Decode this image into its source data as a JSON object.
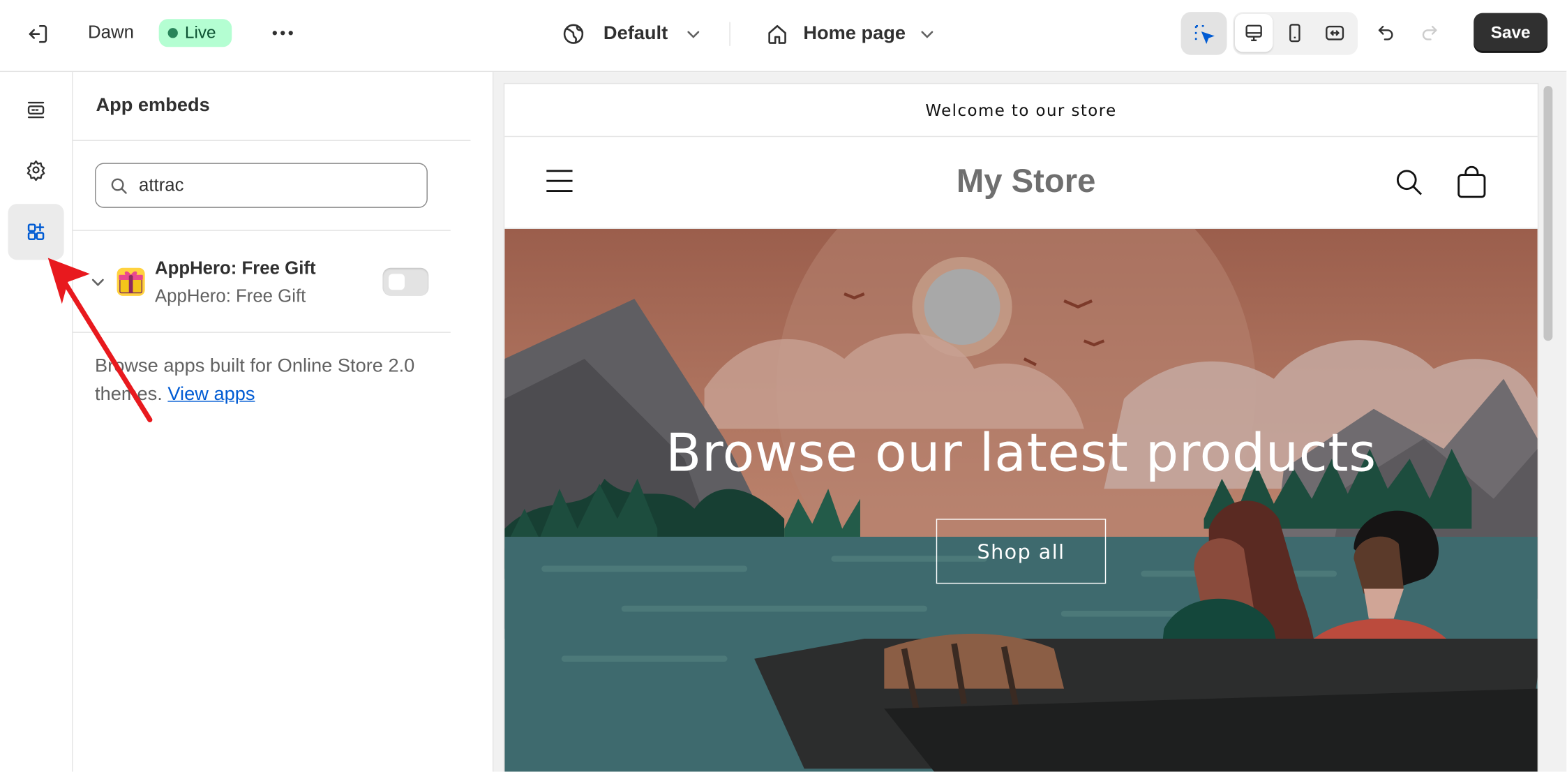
{
  "topbar": {
    "exit_icon": "exit-icon",
    "theme_name": "Dawn",
    "live_label": "Live",
    "more_icon": "more-horizontal-icon",
    "language_icon": "globe-icon",
    "language_label": "Default",
    "page_icon": "home-icon",
    "page_label": "Home page",
    "inspector_icon": "inspector-cursor-icon",
    "view_icons": [
      "desktop-icon",
      "mobile-icon",
      "fullscreen-icon"
    ],
    "undo_icon": "undo-icon",
    "redo_icon": "redo-icon",
    "save_label": "Save"
  },
  "rail": {
    "items": [
      {
        "icon": "sections-icon"
      },
      {
        "icon": "settings-gear-icon"
      },
      {
        "icon": "app-embeds-icon",
        "active": true
      }
    ]
  },
  "panel": {
    "title": "App embeds",
    "search": {
      "value": "attrac",
      "placeholder": "Search app embeds"
    },
    "apps": [
      {
        "title": "AppHero: Free Gift",
        "subtitle": "AppHero: Free Gift",
        "enabled": false
      }
    ],
    "browse_text": "Browse apps built for Online Store 2.0 themes.",
    "browse_link": "View apps"
  },
  "preview": {
    "announcement": "Welcome to our store",
    "store_name": "My Store",
    "hero_heading": "Browse our latest products",
    "hero_button": "Shop all"
  },
  "colors": {
    "live_badge_bg": "#b4fed2",
    "accent_blue": "#005bd3",
    "save_bg": "#303030",
    "annotation_arrow": "#e8191e"
  }
}
